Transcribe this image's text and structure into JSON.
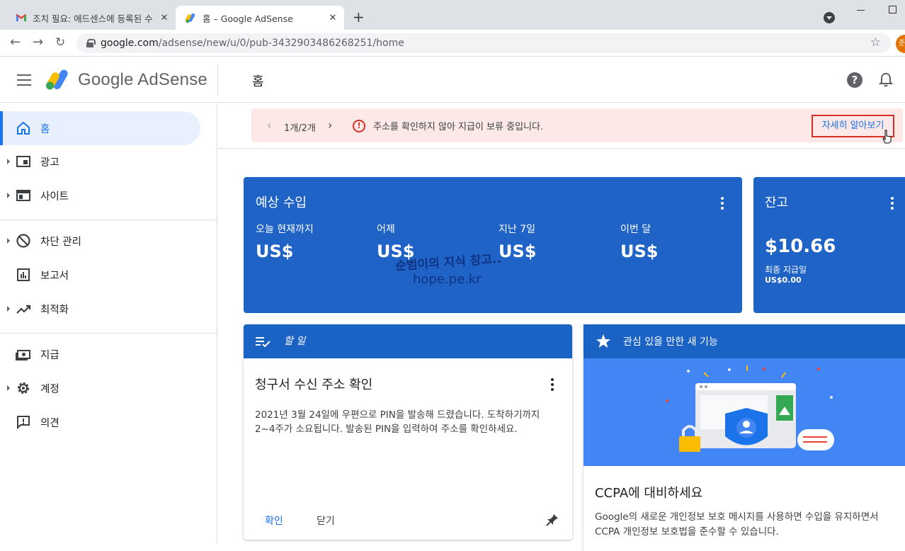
{
  "browser": {
    "tabs": [
      {
        "title": "조치 필요: 애드센스에 등록된 수",
        "active": false,
        "icon": "gmail-icon"
      },
      {
        "title": "홈 – Google AdSense",
        "active": true,
        "icon": "adsense-icon"
      }
    ],
    "new_tab": "+",
    "close_glyph": "✕",
    "url_host": "google.com",
    "url_path": "/adsense/new/u/0/pub-3432903486268251/home",
    "profile_initial": "준"
  },
  "header": {
    "logo_text": "Google AdSense",
    "page_title": "홈",
    "help_glyph": "?"
  },
  "sidebar": {
    "items": [
      {
        "label": "홈",
        "icon": "home-icon",
        "active": true,
        "expandable": false
      },
      {
        "label": "광고",
        "icon": "ads-icon",
        "active": false,
        "expandable": true
      },
      {
        "label": "사이트",
        "icon": "sites-icon",
        "active": false,
        "expandable": true
      },
      {
        "label": "차단 관리",
        "icon": "block-icon",
        "active": false,
        "expandable": true
      },
      {
        "label": "보고서",
        "icon": "reports-icon",
        "active": false,
        "expandable": false
      },
      {
        "label": "최적화",
        "icon": "optimization-icon",
        "active": false,
        "expandable": true
      },
      {
        "label": "지급",
        "icon": "payments-icon",
        "active": false,
        "expandable": false
      },
      {
        "label": "계정",
        "icon": "account-gear-icon",
        "active": false,
        "expandable": true
      },
      {
        "label": "의견",
        "icon": "feedback-icon",
        "active": false,
        "expandable": false
      }
    ]
  },
  "banner": {
    "counter": "1개/2개",
    "alert_glyph": "!",
    "message": "주소를 확인하지 않아 지급이 보류 중입니다.",
    "learn_more": "자세히 알아보기",
    "bg_color": "#fce8e6"
  },
  "estimated_earnings": {
    "title": "예상 수입",
    "metrics": [
      {
        "label": "오늘 현재까지",
        "value": "US$"
      },
      {
        "label": "어제",
        "value": "US$"
      },
      {
        "label": "지난 7일",
        "value": "US$"
      },
      {
        "label": "이번 달",
        "value": "US$"
      }
    ],
    "watermark_line1": "순범이의 지식 창고..",
    "watermark_line2": "hope.pe.kr",
    "color": "#1e63c5"
  },
  "balance": {
    "title": "잔고",
    "value": "$10.66",
    "last_payment_label": "최종 지급일",
    "last_payment_value": "US$0.00"
  },
  "todo": {
    "header": "할 일",
    "heading": "청구서 수신 주소 확인",
    "body": "2021년 3월 24일에 우편으로 PIN을 발송해 드렸습니다. 도착하기까지 2~4주가 소요됩니다. 발송된 PIN을 입력하여 주소를 확인하세요.",
    "confirm_label": "확인",
    "close_label": "닫기"
  },
  "new_features": {
    "header": "관심 있을 만한 새 기능",
    "heading": "CCPA에 대비하세요",
    "body": "Google의 새로운 개인정보 보호 메시지를 사용하면 수입을 유지하면서 CCPA 개인정보 보호법을 준수할 수 있습니다."
  },
  "colors": {
    "accent": "#1a73e8",
    "card_blue": "#1a63c4",
    "alert_red": "#d93025"
  }
}
